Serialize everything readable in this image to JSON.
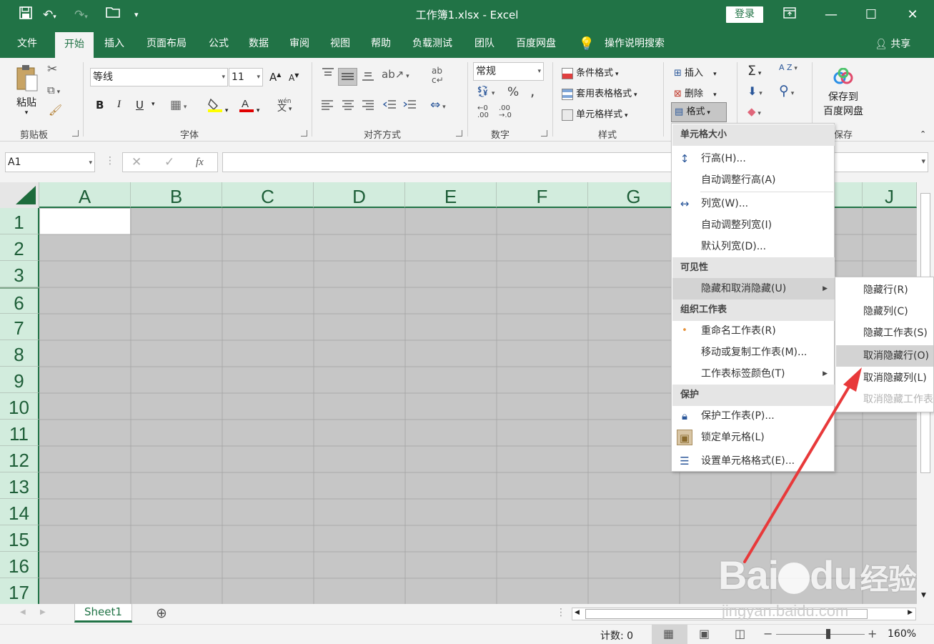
{
  "window": {
    "title": "工作簿1.xlsx  -  Excel",
    "login_label": "登录",
    "minimize_label": "—",
    "maximize_label": "☐",
    "close_label": "✕"
  },
  "tabs": [
    {
      "label": "文件",
      "active": false
    },
    {
      "label": "开始",
      "active": true
    },
    {
      "label": "插入",
      "active": false
    },
    {
      "label": "页面布局",
      "active": false
    },
    {
      "label": "公式",
      "active": false
    },
    {
      "label": "数据",
      "active": false
    },
    {
      "label": "审阅",
      "active": false
    },
    {
      "label": "视图",
      "active": false
    },
    {
      "label": "帮助",
      "active": false
    },
    {
      "label": "负载测试",
      "active": false
    },
    {
      "label": "团队",
      "active": false
    },
    {
      "label": "百度网盘",
      "active": false
    }
  ],
  "tell_me": "操作说明搜索",
  "share_label": "共享",
  "ribbon": {
    "clipboard": {
      "paste_label": "粘贴",
      "group_label": "剪贴板"
    },
    "font": {
      "font_name": "等线",
      "font_size": "11",
      "bold": "B",
      "italic": "I",
      "underline": "U",
      "grow": "A",
      "shrink": "A",
      "wen": "wén",
      "wen_char": "文",
      "group_label": "字体"
    },
    "alignment": {
      "group_label": "对齐方式"
    },
    "number": {
      "format": "常规",
      "percent": "%",
      "comma": ",",
      "group_label": "数字"
    },
    "styles": {
      "conditional": "条件格式",
      "table": "套用表格格式",
      "cell_styles": "单元格样式",
      "group_label": "样式"
    },
    "cells": {
      "insert": "插入",
      "delete": "删除",
      "format": "格式"
    },
    "editing": {
      "sum": "Σ",
      "sort": "A Z",
      "find": "⚲"
    },
    "baidu": {
      "save_line1": "保存到",
      "save_line2": "百度网盘",
      "group_label": "保存"
    }
  },
  "formula_bar": {
    "name_box": "A1",
    "cancel": "✕",
    "enter": "✓",
    "fx": "fx",
    "value": ""
  },
  "columns": [
    "A",
    "B",
    "C",
    "D",
    "E",
    "F",
    "G",
    "H",
    "I",
    "J"
  ],
  "rows": [
    "1",
    "2",
    "3",
    "6",
    "7",
    "8",
    "9",
    "10",
    "11",
    "12",
    "13",
    "14",
    "15",
    "16",
    "17"
  ],
  "sheets": [
    {
      "label": "Sheet1"
    }
  ],
  "status": {
    "count_label": "计数: 0",
    "zoom": "160%",
    "zoom_minus": "−",
    "zoom_plus": "+"
  },
  "format_menu": {
    "sections": [
      {
        "header": "单元格大小",
        "items": [
          {
            "label": "行高(H)...",
            "icon": "row-height-icon"
          },
          {
            "label": "自动调整行高(A)",
            "icon": ""
          }
        ]
      },
      {
        "header": "",
        "items": [
          {
            "label": "列宽(W)...",
            "icon": "column-width-icon"
          },
          {
            "label": "自动调整列宽(I)",
            "icon": ""
          },
          {
            "label": "默认列宽(D)...",
            "icon": ""
          }
        ]
      },
      {
        "header": "可见性",
        "items": [
          {
            "label": "隐藏和取消隐藏(U)",
            "icon": "",
            "submenu": true,
            "highlighted": true
          }
        ]
      },
      {
        "header": "组织工作表",
        "items": [
          {
            "label": "重命名工作表(R)",
            "icon": "bullet-icon"
          },
          {
            "label": "移动或复制工作表(M)...",
            "icon": ""
          },
          {
            "label": "工作表标签颜色(T)",
            "icon": "",
            "submenu": true
          }
        ]
      },
      {
        "header": "保护",
        "items": [
          {
            "label": "保护工作表(P)...",
            "icon": "protect-sheet-icon"
          },
          {
            "label": "锁定单元格(L)",
            "icon": "lock-icon"
          },
          {
            "label": "设置单元格格式(E)...",
            "icon": "format-cells-icon"
          }
        ]
      }
    ]
  },
  "hide_submenu": [
    {
      "label": "隐藏行(R)",
      "state": "normal"
    },
    {
      "label": "隐藏列(C)",
      "state": "normal"
    },
    {
      "label": "隐藏工作表(S)",
      "state": "normal"
    },
    {
      "label": "取消隐藏行(O)",
      "state": "highlighted"
    },
    {
      "label": "取消隐藏列(L)",
      "state": "normal"
    },
    {
      "label": "取消隐藏工作表",
      "state": "disabled"
    }
  ],
  "watermark": {
    "brand": "Bai",
    "brand_du": "du",
    "brand_cn": "经验",
    "url": "jingyan.baidu.com"
  },
  "colors": {
    "excel_green": "#217346",
    "header_green": "#d2ecdd",
    "selection_gray": "#c6c6c6",
    "annotation_red": "#e8393a"
  }
}
